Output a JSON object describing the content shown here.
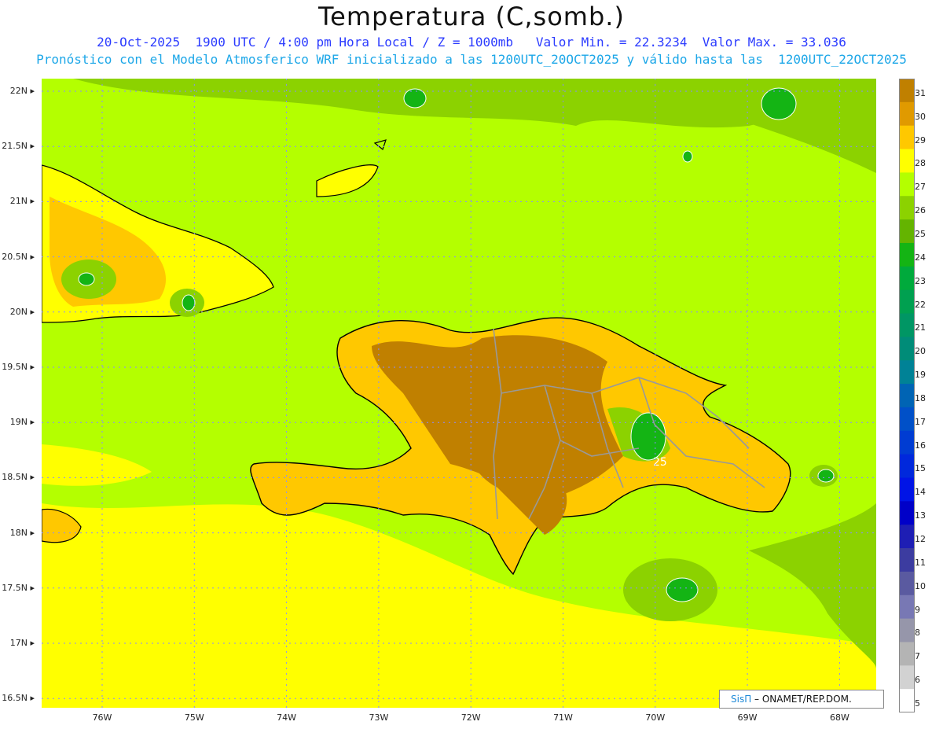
{
  "header": {
    "title": "Temperatura (C,somb.)",
    "line1": "20-Oct-2025  1900 UTC / 4:00 pm Hora Local / Z = 1000mb   Valor Min. = 22.3234  Valor Max. = 33.036",
    "line2": "Pronóstico con el Modelo Atmosferico WRF inicializado a las 1200UTC_20OCT2025 y válido hasta las  1200UTC_22OCT2025"
  },
  "axes": {
    "lat_labels": [
      "22N",
      "21.5N",
      "21N",
      "20.5N",
      "20N",
      "19.5N",
      "19N",
      "18.5N",
      "18N",
      "17.5N",
      "17N",
      "16.5N"
    ],
    "lon_labels": [
      "76W",
      "75W",
      "74W",
      "73W",
      "72W",
      "71W",
      "70W",
      "69W",
      "68W"
    ]
  },
  "legend": {
    "levels": [
      "31",
      "30",
      "29",
      "28",
      "27",
      "26",
      "25",
      "24",
      "23",
      "22",
      "21",
      "20",
      "19",
      "18",
      "17",
      "16",
      "15",
      "14",
      "13",
      "12",
      "11",
      "10",
      "9",
      "8",
      "7",
      "6",
      "5"
    ],
    "colors": [
      "#c08000",
      "#e09a00",
      "#ffc800",
      "#ffff00",
      "#b4ff00",
      "#8cd200",
      "#64b400",
      "#14b414",
      "#00aa3c",
      "#00a050",
      "#009664",
      "#008c78",
      "#008296",
      "#0064b4",
      "#0050c8",
      "#003cd2",
      "#0028dc",
      "#0014e6",
      "#0000c8",
      "#1e1eb4",
      "#3c3ca0",
      "#5a5aa0",
      "#7878b4",
      "#9696aa",
      "#b4b4b4",
      "#d2d2d2",
      "#ffffff"
    ]
  },
  "contour_label": "25",
  "credit": {
    "brand": "SisΠ",
    "text": " – ONAMET/REP.DOM."
  }
}
